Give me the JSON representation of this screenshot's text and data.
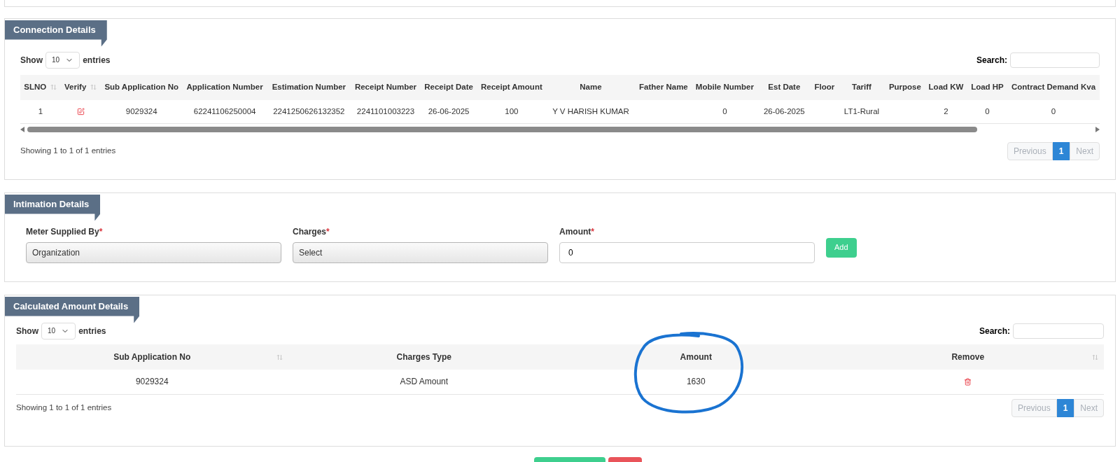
{
  "connection_details": {
    "title": "Connection Details",
    "length": {
      "prefix": "Show",
      "value": "10",
      "suffix": "entries"
    },
    "search": {
      "label": "Search:"
    },
    "columns": [
      {
        "label": "SLNO",
        "sortable": true
      },
      {
        "label": "Verify",
        "sortable": true
      },
      {
        "label": "Sub Application No",
        "sortable": false
      },
      {
        "label": "Application Number",
        "sortable": false
      },
      {
        "label": "Estimation Number",
        "sortable": false
      },
      {
        "label": "Receipt Number",
        "sortable": false
      },
      {
        "label": "Receipt Date",
        "sortable": false
      },
      {
        "label": "Receipt Amount",
        "sortable": false
      },
      {
        "label": "Name",
        "sortable": false
      },
      {
        "label": "Father Name",
        "sortable": false
      },
      {
        "label": "Mobile Number",
        "sortable": false
      },
      {
        "label": "Est Date",
        "sortable": false
      },
      {
        "label": "Floor",
        "sortable": false
      },
      {
        "label": "Tariff",
        "sortable": false
      },
      {
        "label": "Purpose",
        "sortable": false
      },
      {
        "label": "Load KW",
        "sortable": false
      },
      {
        "label": "Load HP",
        "sortable": false
      },
      {
        "label": "Contract Demand Kva",
        "sortable": false
      }
    ],
    "rows": [
      {
        "cells": [
          {
            "kind": "text",
            "text": "1"
          },
          {
            "kind": "edit"
          },
          {
            "kind": "text",
            "text": "9029324"
          },
          {
            "kind": "text",
            "text": "62241106250004"
          },
          {
            "kind": "text",
            "text": "2241250626132352"
          },
          {
            "kind": "text",
            "text": "2241101003223"
          },
          {
            "kind": "text",
            "text": "26-06-2025"
          },
          {
            "kind": "text",
            "text": "100"
          },
          {
            "kind": "text",
            "text": "Y V HARISH KUMAR"
          },
          {
            "kind": "empty"
          },
          {
            "kind": "text",
            "text": "0"
          },
          {
            "kind": "text",
            "text": "26-06-2025"
          },
          {
            "kind": "empty"
          },
          {
            "kind": "text",
            "text": "LT1-Rural"
          },
          {
            "kind": "empty"
          },
          {
            "kind": "text",
            "text": "2"
          },
          {
            "kind": "text",
            "text": "0"
          },
          {
            "kind": "text",
            "text": "0"
          }
        ]
      }
    ],
    "info": "Showing 1 to 1 of 1 entries",
    "pagination": [
      {
        "label": "Previous",
        "selected": false,
        "disabled": true
      },
      {
        "label": "1",
        "selected": true,
        "disabled": false
      },
      {
        "label": "Next",
        "selected": false,
        "disabled": true
      }
    ]
  },
  "intimation_details": {
    "title": "Intimation Details",
    "fields": [
      {
        "kind": "select",
        "label": "Meter Supplied By",
        "required_mark": "*",
        "value": "Organization"
      },
      {
        "kind": "select",
        "label": "Charges",
        "required_mark": "*",
        "value": "Select"
      },
      {
        "kind": "input",
        "label": "Amount",
        "required_mark": "*",
        "value": "0"
      }
    ],
    "add_button": "Add"
  },
  "calculated_amount_details": {
    "title": "Calculated Amount Details",
    "length": {
      "prefix": "Show",
      "value": "10",
      "suffix": "entries"
    },
    "search": {
      "label": "Search:"
    },
    "columns": [
      {
        "label": "Sub Application No",
        "sortable": true
      },
      {
        "label": "Charges Type",
        "sortable": false
      },
      {
        "label": "Amount",
        "sortable": false
      },
      {
        "label": "Remove",
        "sortable": true
      }
    ],
    "rows": [
      {
        "cells": [
          {
            "kind": "text",
            "text": "9029324"
          },
          {
            "kind": "text",
            "text": "ASD Amount"
          },
          {
            "kind": "text",
            "text": "1630"
          },
          {
            "kind": "delete"
          }
        ]
      }
    ],
    "info": "Showing 1 to 1 of 1 entries",
    "pagination": [
      {
        "label": "Previous",
        "selected": false,
        "disabled": true
      },
      {
        "label": "1",
        "selected": true,
        "disabled": false
      },
      {
        "label": "Next",
        "selected": false,
        "disabled": true
      }
    ]
  }
}
